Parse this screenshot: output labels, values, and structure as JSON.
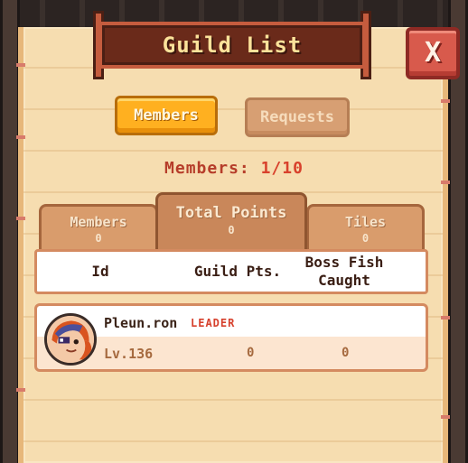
{
  "title": "Guild List",
  "close_label": "X",
  "modes": {
    "active": "Members",
    "inactive": "Requests"
  },
  "members_count": {
    "label": "Members:",
    "value": "1/10"
  },
  "sort_tabs": [
    {
      "label": "Members",
      "value": "0"
    },
    {
      "label": "Total Points",
      "value": "0"
    },
    {
      "label": "Tiles",
      "value": "0"
    }
  ],
  "columns": {
    "id": "Id",
    "guild_pts": "Guild Pts.",
    "boss_fish": "Boss Fish Caught"
  },
  "members": [
    {
      "name": "Pleun.ron",
      "role": "LEADER",
      "level": "Lv.136",
      "guild_pts": "0",
      "boss_fish": "0"
    }
  ],
  "colors": {
    "parchment": "#f6ddb0",
    "banner": "#6a2a1a",
    "title_text": "#fbe29a",
    "active_button": "#ffb020",
    "close_button": "#d85a4c",
    "leader_text": "#d6402c"
  }
}
